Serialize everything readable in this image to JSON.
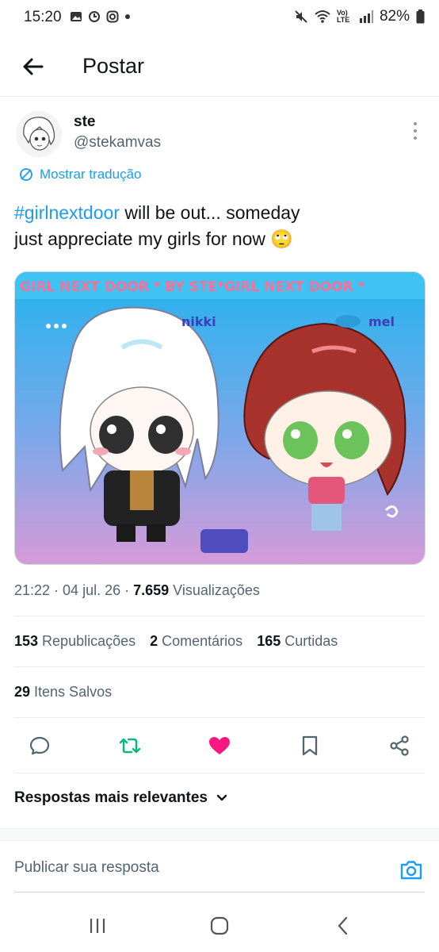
{
  "status_bar": {
    "time": "15:20",
    "battery": "82%",
    "network": "Vo) LTE"
  },
  "header": {
    "title": "Postar",
    "back_icon": "arrow-left-icon"
  },
  "author": {
    "name": "ste",
    "handle": "@stekamvas"
  },
  "translate_label": "Mostrar tradução",
  "tweet": {
    "hashtag": "#girlnextdoor",
    "line1_rest": " will be out... someday",
    "line2": "just appreciate my girls for now 🙄"
  },
  "media": {
    "banner_text": "GIRL NEXT DOOR * BY STE*GIRL NEXT DOOR *",
    "label_left": "nikki",
    "label_right": "mel"
  },
  "meta": {
    "time": "21:22",
    "sep1": " · ",
    "date": "04 jul. 26",
    "sep2": " · ",
    "views_count": "7.659",
    "views_label": " Visualizações"
  },
  "stats": {
    "reposts_count": "153",
    "reposts_label": " Republicações",
    "comments_count": "2",
    "comments_label": " Comentários",
    "likes_count": "165",
    "likes_label": " Curtidas",
    "saved_count": "29",
    "saved_label": " Itens Salvos"
  },
  "actions": {
    "reply_icon": "comment-icon",
    "repost_icon": "repost-icon",
    "like_icon": "heart-icon",
    "bookmark_icon": "bookmark-icon",
    "share_icon": "share-icon"
  },
  "replies": {
    "sort_label": "Respostas mais relevantes"
  },
  "reply_box": {
    "placeholder": "Publicar sua resposta"
  },
  "colors": {
    "accent": "#1d9bf0",
    "repost_active": "#00ba7c",
    "like_active": "#f91880",
    "secondary_text": "#536471"
  }
}
